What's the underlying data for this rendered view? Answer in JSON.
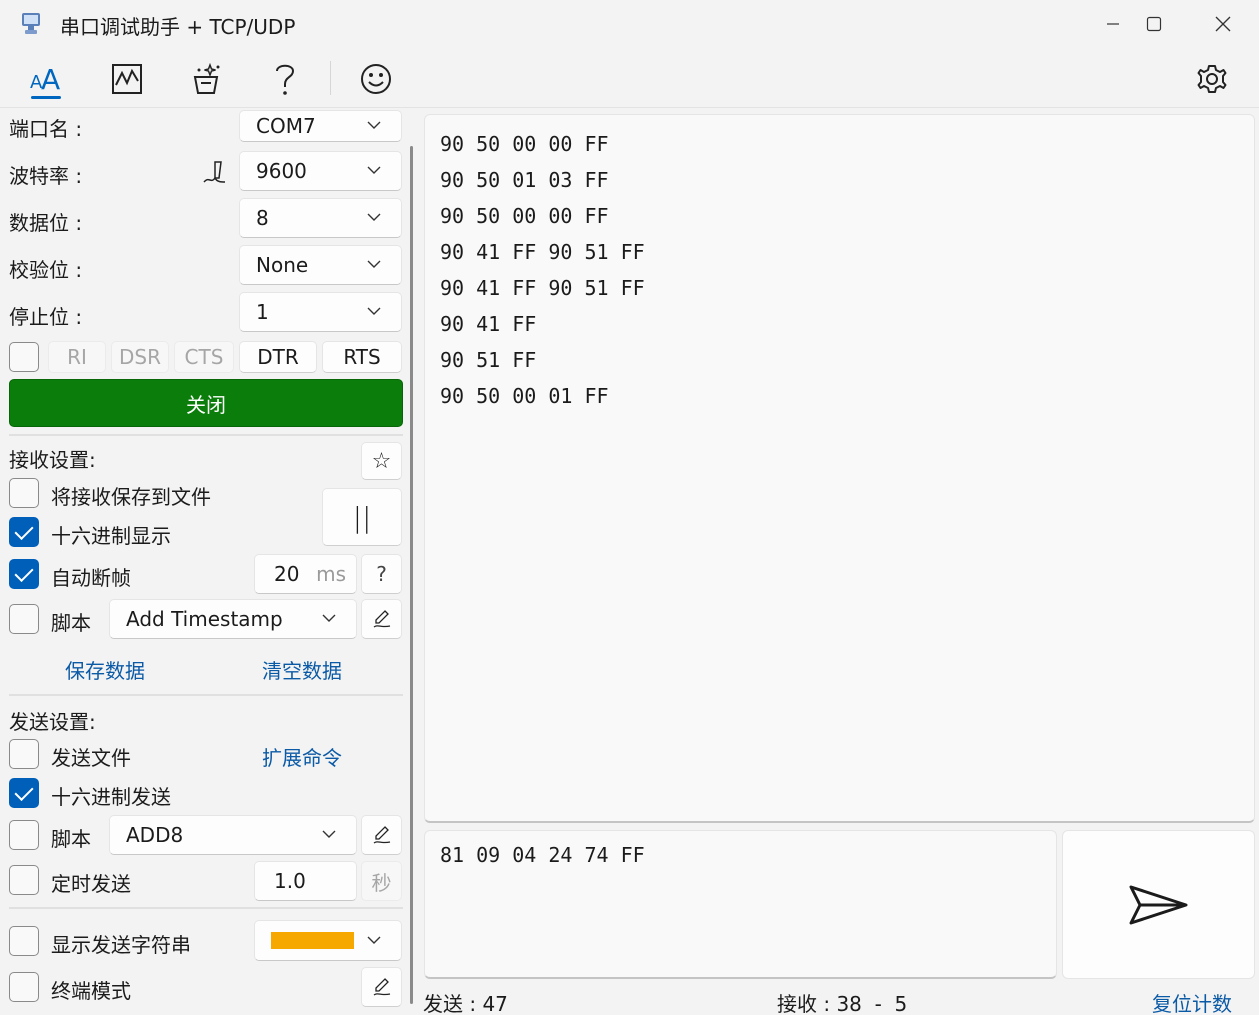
{
  "window": {
    "title": "串口调试助手 + TCP/UDP"
  },
  "toolbar": {
    "items": [
      {
        "icon": "font-size-icon"
      },
      {
        "icon": "chart-icon"
      },
      {
        "icon": "magic-wand-icon"
      },
      {
        "icon": "help-icon"
      },
      {
        "icon": "smiley-icon"
      },
      {
        "icon": "gear-icon"
      }
    ]
  },
  "serial": {
    "port_label": "端口名 :",
    "port_value": "COM7",
    "baud_label": "波特率 :",
    "baud_value": "9600",
    "databits_label": "数据位 :",
    "databits_value": "8",
    "parity_label": "校验位 :",
    "parity_value": "None",
    "stopbits_label": "停止位 :",
    "stopbits_value": "1",
    "signals": [
      "RI",
      "DSR",
      "CTS",
      "DTR",
      "RTS"
    ],
    "open_button": "关闭"
  },
  "receive": {
    "heading": "接收设置:",
    "save_to_file": "将接收保存到文件",
    "save_to_file_checked": false,
    "hex_display": "十六进制显示",
    "hex_display_checked": true,
    "auto_frame": "自动断帧",
    "auto_frame_checked": true,
    "frame_timeout": "20",
    "frame_unit": "ms",
    "help_glyph": "?",
    "script_label": "脚本",
    "script_checked": false,
    "script_value": "Add Timestamp",
    "pause_glyph": "||",
    "star_glyph": "☆",
    "save_data": "保存数据",
    "clear_data": "清空数据",
    "lines": [
      "90 50 00 00 FF",
      "90 50 01 03 FF",
      "90 50 00 00 FF",
      "90 41 FF 90 51 FF",
      "90 41 FF 90 51 FF",
      "90 41 FF",
      "90 51 FF",
      "90 50 00 01 FF"
    ]
  },
  "send": {
    "heading": "发送设置:",
    "send_file": "发送文件",
    "send_file_checked": false,
    "extend_cmd": "扩展命令",
    "hex_send": "十六进制发送",
    "hex_send_checked": true,
    "script_label": "脚本",
    "script_checked": false,
    "script_value": "ADD8",
    "timer_send": "定时发送",
    "timer_checked": false,
    "timer_value": "1.0",
    "timer_unit": "秒",
    "show_send_string": "显示发送字符串",
    "show_send_checked": false,
    "string_color": "#f7a800",
    "terminal_mode": "终端模式",
    "terminal_checked": false,
    "content": "81 09 04 24 74 FF"
  },
  "status": {
    "sent": "发送 : 47",
    "received": "接收 : 38  -  5",
    "reset": "复位计数"
  }
}
